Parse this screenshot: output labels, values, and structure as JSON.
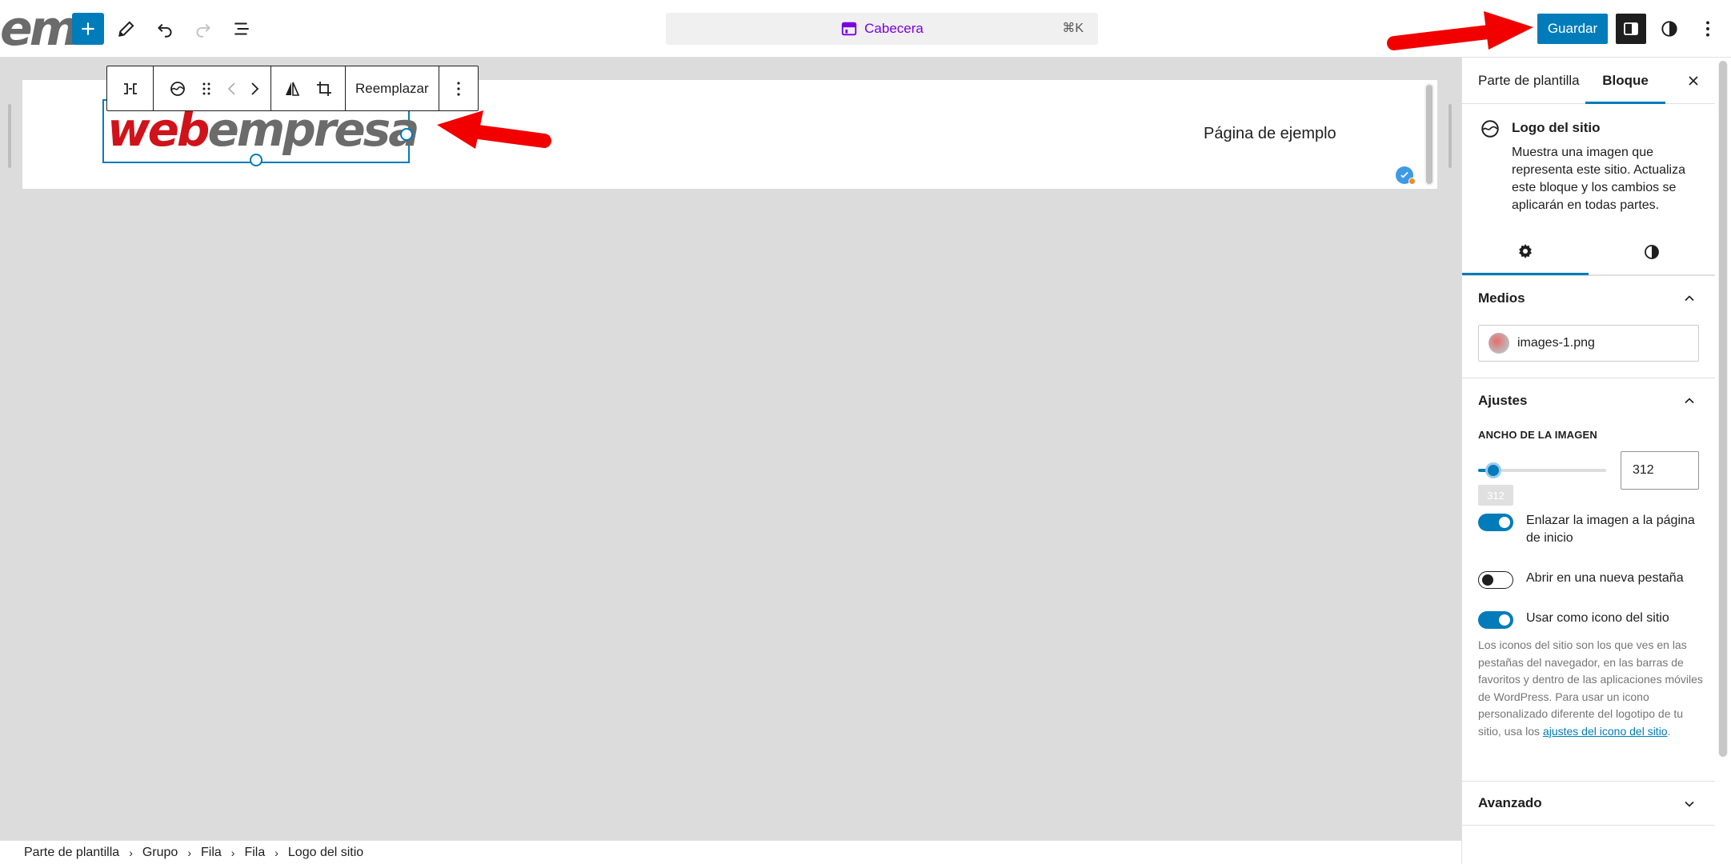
{
  "topbar": {
    "site_logo_partial": "em",
    "document_title": "Cabecera",
    "shortcut": "⌘K",
    "save_label": "Guardar"
  },
  "canvas": {
    "logo_part1": "web",
    "logo_part2": "empresa",
    "nav_link": "Página de ejemplo"
  },
  "block_toolbar": {
    "replace_label": "Reemplazar"
  },
  "breadcrumb": {
    "items": [
      "Parte de plantilla",
      "Grupo",
      "Fila",
      "Fila",
      "Logo del sitio"
    ]
  },
  "sidebar": {
    "tab_template": "Parte de plantilla",
    "tab_block": "Bloque",
    "block_title": "Logo del sitio",
    "block_description": "Muestra una imagen que representa este sitio. Actualiza este bloque y los cambios se aplicarán en todas partes.",
    "media_panel": {
      "title": "Medios",
      "file_name": "images-1.png"
    },
    "settings_panel": {
      "title": "Ajustes",
      "width_label": "ANCHO DE LA IMAGEN",
      "width_value": "312",
      "width_tooltip": "312",
      "slider_fraction": 0.12,
      "toggles": [
        {
          "label": "Enlazar la imagen a la página de inicio",
          "on": true
        },
        {
          "label": "Abrir en una nueva pestaña",
          "on": false
        },
        {
          "label": "Usar como icono del sitio",
          "on": true
        }
      ],
      "help_text": "Los iconos del sitio son los que ves en las pestañas del navegador, en las barras de favoritos y dentro de las aplicaciones móviles de WordPress. Para usar un icono personalizado diferente del logotipo de tu sitio, usa los ",
      "help_link": "ajustes del icono del sitio",
      "help_end": "."
    },
    "advanced_panel": {
      "title": "Avanzado"
    }
  },
  "colors": {
    "accent": "#007cba",
    "purple": "#7a00df",
    "arrow_red": "#f20000",
    "logo_red": "#d0121a",
    "logo_grey": "#6b6b6b"
  }
}
